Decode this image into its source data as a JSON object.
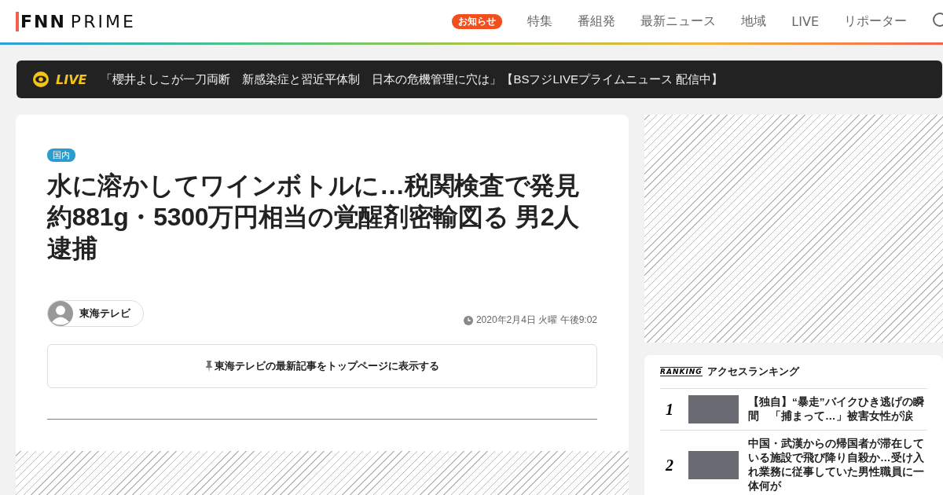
{
  "header": {
    "logo": {
      "brand": "FNN",
      "product": "PRIME"
    },
    "notice_badge": "お知らせ",
    "nav": [
      {
        "label": "特集"
      },
      {
        "label": "番組発"
      },
      {
        "label": "最新ニュース"
      },
      {
        "label": "地域"
      },
      {
        "label": "LIVE"
      },
      {
        "label": "リポーター"
      }
    ]
  },
  "live_bar": {
    "label": "LIVE",
    "text": "「櫻井よしこが一刀両断　新感染症と習近平体制　日本の危機管理に穴は」【BSフジLIVEプライムニュース 配信中】"
  },
  "article": {
    "category": "国内",
    "title": "水に溶かしてワインボトルに…税関検査で発見約881g・5300万円相当の覚醒剤密輸図る 男2人逮捕",
    "source": "東海テレビ",
    "date": "2020年2月4日 火曜 午後9:02",
    "pin_button": "東海テレビの最新記事をトップページに表示する"
  },
  "ranking": {
    "tag": "RANKING",
    "title": "アクセスランキング",
    "items": [
      {
        "rank": "1",
        "title": "【独自】“暴走”バイクひき逃げの瞬間　「捕まって…」被害女性が涙"
      },
      {
        "rank": "2",
        "title": "中国・武漢からの帰国者が滞在している施設で飛び降り自殺か…受け入れ業務に従事していた男性職員に一体何が"
      }
    ]
  }
}
